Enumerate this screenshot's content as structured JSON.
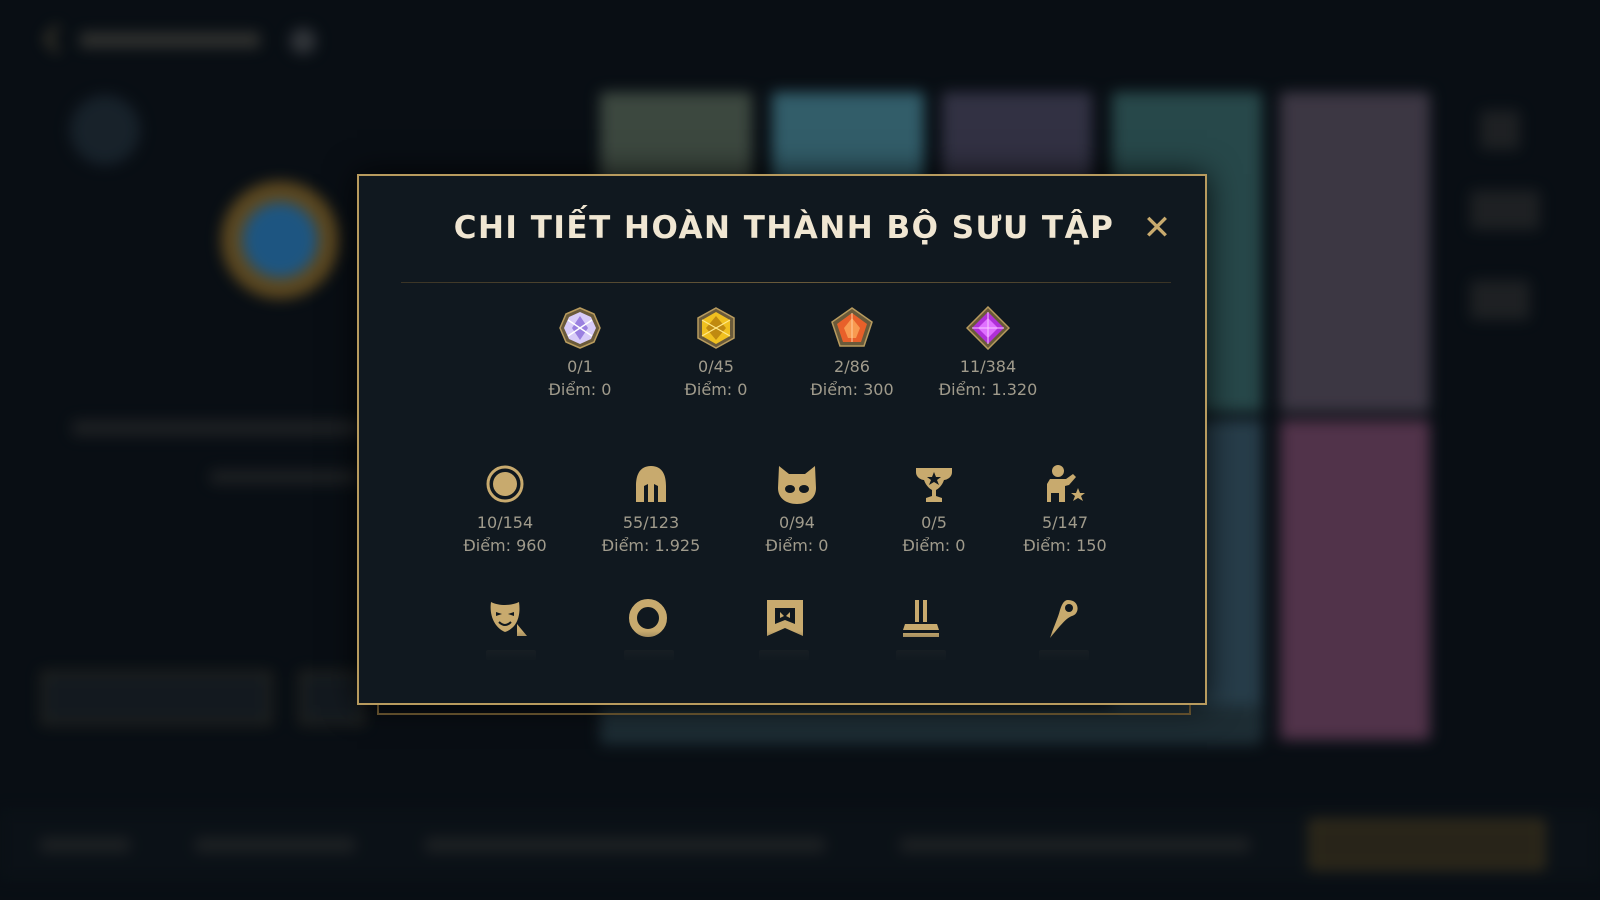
{
  "modal": {
    "title": "CHI TIẾT HOÀN THÀNH BỘ SƯU TẬP",
    "close_symbol": "✕"
  },
  "row1": [
    {
      "icon": "white-gem-icon",
      "count": "0/1",
      "points": "Điểm: 0",
      "color": "#c8b8f0"
    },
    {
      "icon": "gold-gem-icon",
      "count": "0/45",
      "points": "Điểm: 0",
      "color": "#f0b820"
    },
    {
      "icon": "orange-gem-icon",
      "count": "2/86",
      "points": "Điểm: 300",
      "color": "#e8602a"
    },
    {
      "icon": "purple-gem-icon",
      "count": "11/384",
      "points": "Điểm: 1.320",
      "color": "#b030d8"
    }
  ],
  "row2": [
    {
      "icon": "summoner-icon",
      "count": "10/154",
      "points": "Điểm: 960"
    },
    {
      "icon": "helmet-icon",
      "count": "55/123",
      "points": "Điểm: 1.925"
    },
    {
      "icon": "poro-icon",
      "count": "0/94",
      "points": "Điểm: 0"
    },
    {
      "icon": "trophy-icon",
      "count": "0/5",
      "points": "Điểm: 0"
    },
    {
      "icon": "emote-icon",
      "count": "5/147",
      "points": "Điểm: 150"
    }
  ],
  "row3": [
    {
      "icon": "mask-icon"
    },
    {
      "icon": "ring-icon"
    },
    {
      "icon": "banner-icon"
    },
    {
      "icon": "pedestal-icon"
    },
    {
      "icon": "feather-icon"
    }
  ],
  "colors": {
    "accent_gold": "#c8aa6e",
    "text": "#a09b8c",
    "title": "#f0e6d2",
    "panel": "#10181f"
  }
}
